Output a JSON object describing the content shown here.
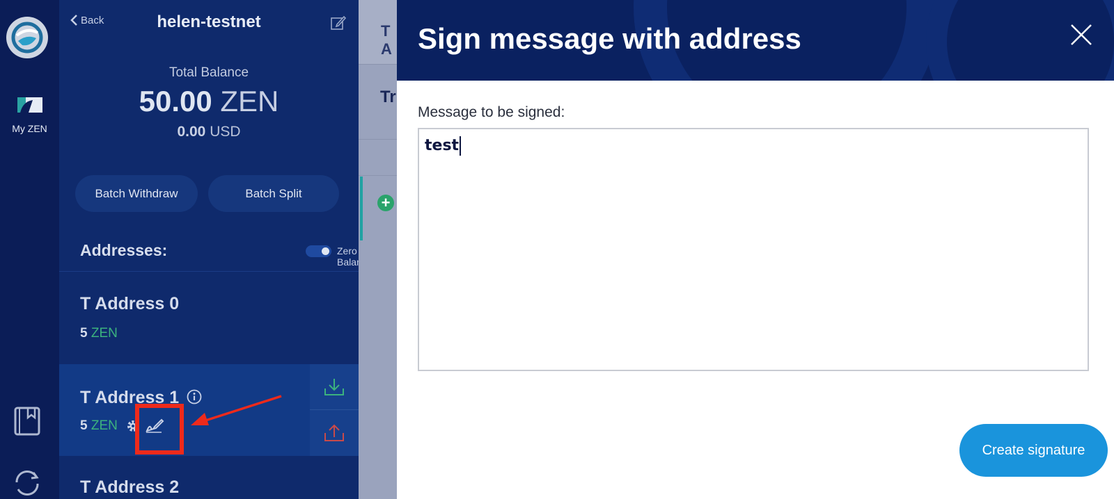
{
  "rail": {
    "logo_icon": "horizen-logo-icon",
    "my_zen_label": "My ZEN",
    "my_zen_icon": "my-zen-icon",
    "bookmark_icon": "address-book-icon",
    "sync_icon": "sync-icon"
  },
  "wallet": {
    "back_label": "Back",
    "name": "helen-testnet",
    "edit_icon": "edit-icon",
    "total_balance_label": "Total Balance",
    "total_balance_value": "50.00",
    "total_balance_unit": "ZEN",
    "usd_value": "0.00",
    "usd_unit": "USD",
    "batch_withdraw_label": "Batch Withdraw",
    "batch_split_label": "Batch Split",
    "addresses_heading": "Addresses:",
    "zero_balances_label": "Zero Balances",
    "addresses": [
      {
        "name": "T Address 0",
        "amount": "5",
        "unit": "ZEN"
      },
      {
        "name": "T Address 1",
        "amount": "5",
        "unit": "ZEN",
        "selected": true
      },
      {
        "name": "T Address 2"
      }
    ]
  },
  "background": {
    "tab_fragment": "T A",
    "heading_fragment": "Tr"
  },
  "modal": {
    "title": "Sign message with address",
    "field_label": "Message to be signed:",
    "message_value": "test",
    "create_button_label": "Create signature"
  },
  "colors": {
    "rail_bg": "#0b1d57",
    "wallet_bg": "#0f2a6c",
    "modal_header_bg": "#0a2160",
    "accent_blue": "#1a94dc",
    "zen_green": "#3cb27e",
    "annotation_red": "#ee2a1b"
  }
}
